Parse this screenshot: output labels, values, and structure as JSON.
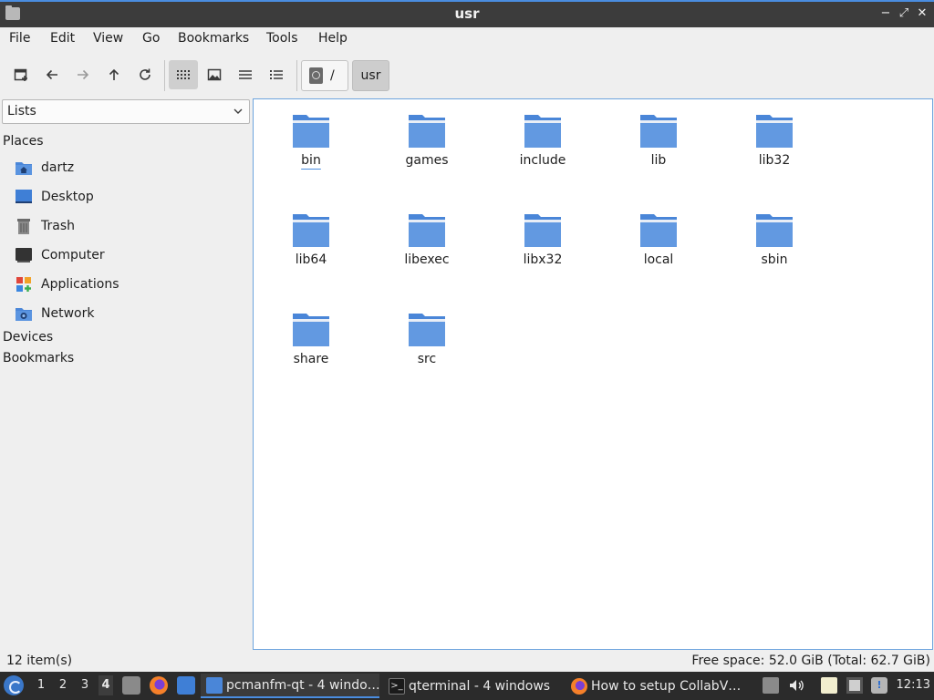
{
  "window": {
    "title": "usr",
    "controls": {
      "minimize": "−",
      "maximize": "⤢",
      "close": "✕"
    }
  },
  "menubar": {
    "items": [
      "File",
      "Edit",
      "View",
      "Go",
      "Bookmarks",
      "Tools",
      "Help"
    ]
  },
  "toolbar": {
    "buttons": [
      "new-tab-icon",
      "back-arrow-icon",
      "forward-arrow-icon",
      "up-arrow-icon",
      "reload-icon",
      "icon-view-icon",
      "thumbnail-view-icon",
      "compact-view-icon",
      "detailed-list-icon"
    ],
    "active_view": "icon-view-icon",
    "path_root_label": "/",
    "path_current_label": "usr"
  },
  "sidebar": {
    "mode_select": "Lists",
    "places_header": "Places",
    "places": [
      {
        "label": "dartz",
        "icon": "home-folder-icon"
      },
      {
        "label": "Desktop",
        "icon": "desktop-icon"
      },
      {
        "label": "Trash",
        "icon": "trash-icon"
      },
      {
        "label": "Computer",
        "icon": "computer-icon"
      },
      {
        "label": "Applications",
        "icon": "applications-icon"
      },
      {
        "label": "Network",
        "icon": "network-icon"
      }
    ],
    "devices_header": "Devices",
    "bookmarks_header": "Bookmarks"
  },
  "files": [
    "bin",
    "games",
    "include",
    "lib",
    "lib32",
    "lib64",
    "libexec",
    "libx32",
    "local",
    "sbin",
    "share",
    "src"
  ],
  "current_item": "bin",
  "statusbar": {
    "item_count": "12 item(s)",
    "free_space": "Free space: 52.0 GiB (Total: 62.7 GiB)"
  },
  "taskbar": {
    "desktops": [
      "1",
      "2",
      "3",
      "4"
    ],
    "active_desktop": "4",
    "quick_launch": [
      "file-manager-icon",
      "firefox-icon",
      "desktop-icon"
    ],
    "tasks": [
      {
        "label": "pcmanfm-qt - 4 windo…",
        "icon": "folder-icon",
        "active": true
      },
      {
        "label": "qterminal - 4 windows",
        "icon": "terminal-icon",
        "active": false
      },
      {
        "label": "How to setup CollabV…",
        "icon": "firefox-icon",
        "active": false
      }
    ],
    "tray": [
      "storage-icon",
      "volume-icon",
      "clipboard-icon",
      "network-tray-icon",
      "update-notifier-icon"
    ],
    "clock": "12:13"
  },
  "colors": {
    "folder": "#4a86d8",
    "folder_top": "#6fa3e6",
    "accent": "#4a8de0",
    "titlebar": "#3c3c3c",
    "taskbar": "#2b2b2b"
  }
}
